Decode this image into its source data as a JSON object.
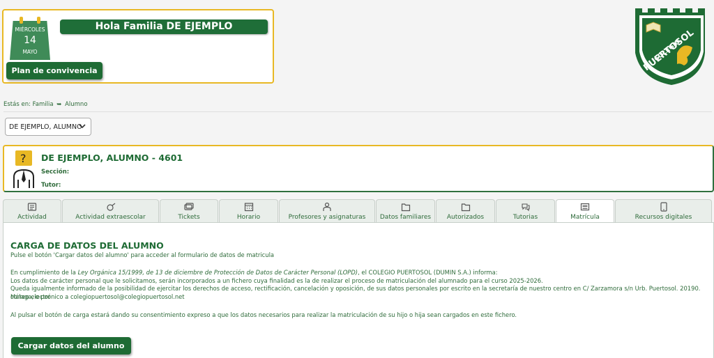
{
  "header": {
    "calendar": {
      "weekday": "MIÉRCOLES",
      "day": "14",
      "month": "MAYO"
    },
    "greeting": "Hola Familia DE EJEMPLO",
    "plan_button": "Plan de convivencia"
  },
  "logo": {
    "line1": "COLEGIO",
    "line2": "PUERTOSOL"
  },
  "breadcrumb": {
    "prefix": "Estás en:",
    "parent": "Familia",
    "separator": "➥",
    "current": "Alumno"
  },
  "student_select": {
    "value": "DE EJEMPLO, ALUMNO"
  },
  "student": {
    "name": "DE EJEMPLO, ALUMNO - 4601",
    "section_label": "Sección:",
    "tutor_label": "Tutor:"
  },
  "tabs": [
    {
      "label": "Actividad",
      "icon": "activity-icon"
    },
    {
      "label": "Actividad extraescolar",
      "icon": "whistle-icon"
    },
    {
      "label": "Tickets",
      "icon": "tickets-icon"
    },
    {
      "label": "Horario",
      "icon": "calendar-icon"
    },
    {
      "label": "Profesores y asignaturas",
      "icon": "teacher-icon"
    },
    {
      "label": "Datos familiares",
      "icon": "folder-icon"
    },
    {
      "label": "Autorizados",
      "icon": "folder-icon"
    },
    {
      "label": "Tutorias",
      "icon": "chat-icon"
    },
    {
      "label": "Matrícula",
      "icon": "id-card-icon"
    },
    {
      "label": "Recursos digitales",
      "icon": "tablet-icon"
    }
  ],
  "active_tab": "Matrícula",
  "content": {
    "title": "CARGA DE DATOS DEL ALUMNO",
    "subtitle": "Pulse el botón 'Cargar datos del alumno' para acceder al formulario de datos de matricula",
    "law_prefix": "En cumplimiento de la ",
    "law_name": "Ley Orgánica 15/1999, de 13 de diciembre de Protección de Datos de Carácter Personal (LOPD)",
    "law_suffix": ", el COLEGIO PUERTOSOL (DUMIN S.A.) informa:",
    "p2": "Los datos de carácter personal que le solicitamos, serán incorporados a un fichero cuya finalidad es la de realizar el proceso de matriculación del alumnado para el curso 2025-2026.",
    "p3a": "Queda igualmente informado de la posibilidad de ejercitar los derechos de acceso, rectificación, cancelación y oposición, de sus datos personales por escrito en la secretaría de nuestro centro en C/ Zarzamora s/n Urb. Puertosol. 20190. Málaga, o por",
    "p3b": "correo electrónico a colegiopuertosol@colegiopuertosol.net",
    "p4": "Al pulsar el botón de carga estará dando su consentimiento expreso a que los datos necesarios para realizar la matriculación de su hijo o hija sean cargados en este fichero.",
    "load_button": "Cargar datos del alumno"
  },
  "colors": {
    "brand_green": "#1e6b34",
    "accent_gold": "#e8b824"
  }
}
